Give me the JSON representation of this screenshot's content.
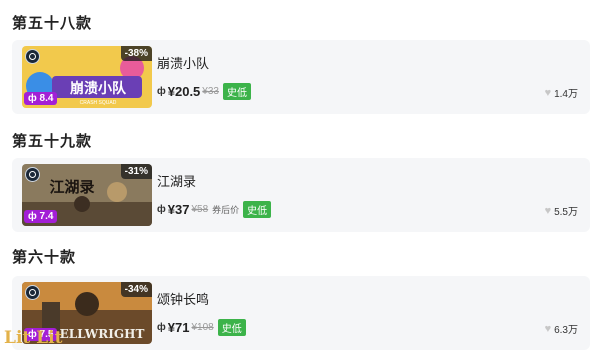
{
  "sections": [
    {
      "title": "第五十八款",
      "name": "崩溃小队",
      "discount": "-38%",
      "score": "8.4",
      "price": "¥20.5",
      "orig": "¥33",
      "coupon": "",
      "tag": "史低",
      "likes": "1.4万",
      "art": "崩溃小队",
      "art_sub": "CRASH SQUAD"
    },
    {
      "title": "第五十九款",
      "name": "江湖录",
      "discount": "-31%",
      "score": "7.4",
      "price": "¥37",
      "orig": "¥58",
      "coupon": "券后价",
      "tag": "史低",
      "likes": "5.5万",
      "art": "江湖录",
      "art_sub": ""
    },
    {
      "title": "第六十款",
      "name": "颂钟长鸣",
      "discount": "-34%",
      "score": "7.5",
      "price": "¥71",
      "orig": "¥108",
      "coupon": "",
      "tag": "史低",
      "likes": "6.3万",
      "art": "ELLWRIGHT",
      "art_sub": ""
    }
  ],
  "icons": {
    "platform": "steam-icon",
    "price": "coin-icon",
    "likes": "heart-icon"
  },
  "colors": {
    "score_badge": "#a31fd6",
    "lowest_tag": "#3cb34a",
    "card_bg": "#f5f6f8"
  },
  "watermark": "Lit  Lit"
}
